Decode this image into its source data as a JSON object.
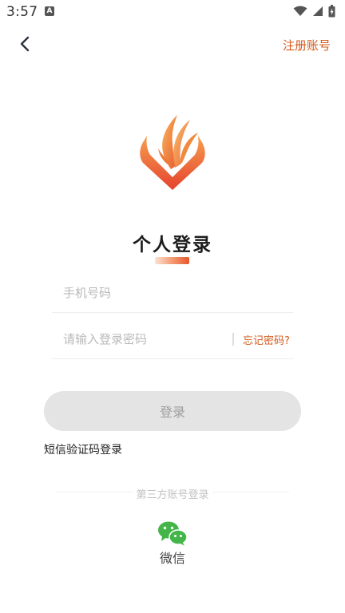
{
  "status_bar": {
    "time": "3:57",
    "app_icon": "A",
    "icons": [
      "wifi-icon",
      "signal-icon",
      "battery-icon"
    ]
  },
  "header": {
    "back_icon": "chevron-left-icon",
    "register_label": "注册账号"
  },
  "title": "个人登录",
  "form": {
    "phone_placeholder": "手机号码",
    "password_placeholder": "请输入登录密码",
    "forgot_label": "忘记密码?",
    "login_label": "登录",
    "sms_login_label": "短信验证码登录"
  },
  "third_party": {
    "label": "第三方账号登录",
    "wechat_label": "微信",
    "wechat_icon": "wechat-icon"
  },
  "colors": {
    "accent": "#d35a1c",
    "wechat_green": "#44b549",
    "button_bg": "#e4e4e4"
  }
}
